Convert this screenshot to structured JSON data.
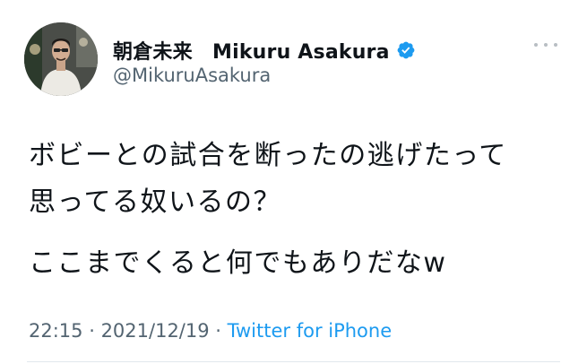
{
  "user": {
    "display_name": "朝倉未来　Mikuru Asakura",
    "handle": "@MikuruAsakura",
    "verified": true,
    "avatar_icon": "profile-photo"
  },
  "tweet": {
    "lines": [
      "ボビーとの試合を断ったの逃げたって",
      "思ってる奴いるの？",
      "ここまでくると何でもありだなw"
    ]
  },
  "meta": {
    "time": "22:15",
    "separator": " · ",
    "date": "2021/12/19",
    "source": "Twitter for iPhone"
  },
  "colors": {
    "text": "#0f1419",
    "secondary": "#536471",
    "link": "#1d9bf0",
    "verified_badge": "#1d9bf0"
  },
  "icons": {
    "more": "more-dots-icon",
    "verified": "verified-badge-icon"
  }
}
